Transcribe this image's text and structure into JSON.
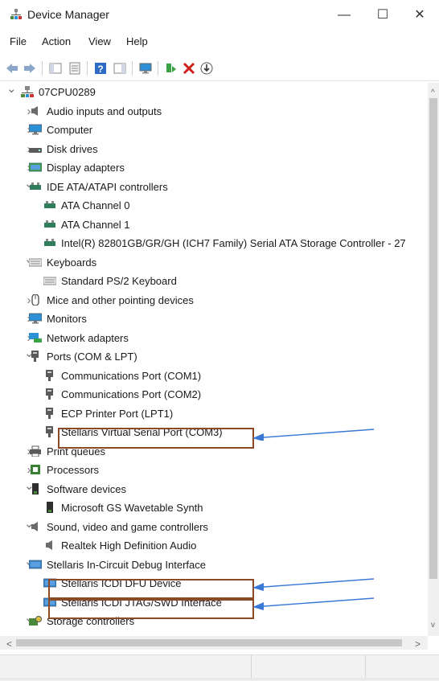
{
  "window": {
    "title": "Device Manager",
    "minimize": "—",
    "maximize": "☐",
    "close": "✕"
  },
  "menu": [
    "File",
    "Action",
    "View",
    "Help"
  ],
  "toolbar_icons": [
    "back-arrow-icon",
    "forward-arrow-icon",
    "show-hide-console-icon",
    "properties-icon",
    "help-icon",
    "action-pane-icon",
    "monitor-icon",
    "update-driver-icon",
    "uninstall-icon",
    "scan-hardware-icon"
  ],
  "tree": [
    {
      "label": "07CPU0289",
      "chev": "v",
      "icon": "computer-icon",
      "color": "#6b6b6b"
    },
    {
      "label": "Audio inputs and outputs",
      "chev": ">",
      "icon": "speaker-icon",
      "color": "#6b6b6b"
    },
    {
      "label": "Computer",
      "chev": ">",
      "icon": "monitor-icon",
      "color": "#2d8fd5"
    },
    {
      "label": "Disk drives",
      "chev": ">",
      "icon": "disk-icon",
      "color": "#5a5a5a"
    },
    {
      "label": "Display adapters",
      "chev": ">",
      "icon": "display-adapter-icon",
      "color": "#3aa346"
    },
    {
      "label": "IDE ATA/ATAPI controllers",
      "chev": "v",
      "icon": "ide-controller-icon",
      "color": "#2f7d5b"
    },
    {
      "label": "ATA Channel 0",
      "chev": "",
      "icon": "ide-controller-icon",
      "color": "#2f7d5b"
    },
    {
      "label": "ATA Channel 1",
      "chev": "",
      "icon": "ide-controller-icon",
      "color": "#2f7d5b"
    },
    {
      "label": "Intel(R) 82801GB/GR/GH (ICH7 Family) Serial ATA Storage Controller - 27",
      "chev": "",
      "icon": "ide-controller-icon",
      "color": "#2f7d5b"
    },
    {
      "label": "Keyboards",
      "chev": "v",
      "icon": "keyboard-icon",
      "color": "#8a8a8a"
    },
    {
      "label": "Standard PS/2 Keyboard",
      "chev": "",
      "icon": "keyboard-icon",
      "color": "#8a8a8a"
    },
    {
      "label": "Mice and other pointing devices",
      "chev": ">",
      "icon": "mouse-icon",
      "color": "#555555"
    },
    {
      "label": "Monitors",
      "chev": ">",
      "icon": "monitor-icon",
      "color": "#2d8fd5"
    },
    {
      "label": "Network adapters",
      "chev": ">",
      "icon": "network-icon",
      "color": "#2d8fd5"
    },
    {
      "label": "Ports (COM & LPT)",
      "chev": "v",
      "icon": "port-icon",
      "color": "#5a5a5a"
    },
    {
      "label": "Communications Port (COM1)",
      "chev": "",
      "icon": "port-icon",
      "color": "#5a5a5a"
    },
    {
      "label": "Communications Port (COM2)",
      "chev": "",
      "icon": "port-icon",
      "color": "#5a5a5a"
    },
    {
      "label": "ECP Printer Port (LPT1)",
      "chev": "",
      "icon": "port-icon",
      "color": "#5a5a5a"
    },
    {
      "label": "Stellaris Virtual Serial Port (COM3)",
      "chev": "",
      "icon": "port-icon",
      "color": "#5a5a5a"
    },
    {
      "label": "Print queues",
      "chev": ">",
      "icon": "printer-icon",
      "color": "#5a5a5a"
    },
    {
      "label": "Processors",
      "chev": ">",
      "icon": "processor-icon",
      "color": "#3a7f35"
    },
    {
      "label": "Software devices",
      "chev": "v",
      "icon": "software-device-icon",
      "color": "#2f2f2f"
    },
    {
      "label": "Microsoft GS Wavetable Synth",
      "chev": "",
      "icon": "software-device-icon",
      "color": "#2f2f2f"
    },
    {
      "label": "Sound, video and game controllers",
      "chev": "v",
      "icon": "speaker-icon",
      "color": "#6b6b6b"
    },
    {
      "label": "Realtek High Definition Audio",
      "chev": "",
      "icon": "speaker-icon",
      "color": "#6b6b6b"
    },
    {
      "label": "Stellaris In-Circuit Debug Interface",
      "chev": "v",
      "icon": "display-adapter-icon",
      "color": "#3b86c9"
    },
    {
      "label": "Stellaris ICDI DFU Device",
      "chev": "",
      "icon": "display-adapter-icon",
      "color": "#3b86c9"
    },
    {
      "label": "Stellaris ICDI JTAG/SWD Interface",
      "chev": "",
      "icon": "display-adapter-icon",
      "color": "#3b86c9"
    },
    {
      "label": "Storage controllers",
      "chev": "v",
      "icon": "storage-icon",
      "color": "#4a8a3a"
    }
  ],
  "annotation_color": "#3a78d6",
  "highlight_color": "#8b4a23"
}
